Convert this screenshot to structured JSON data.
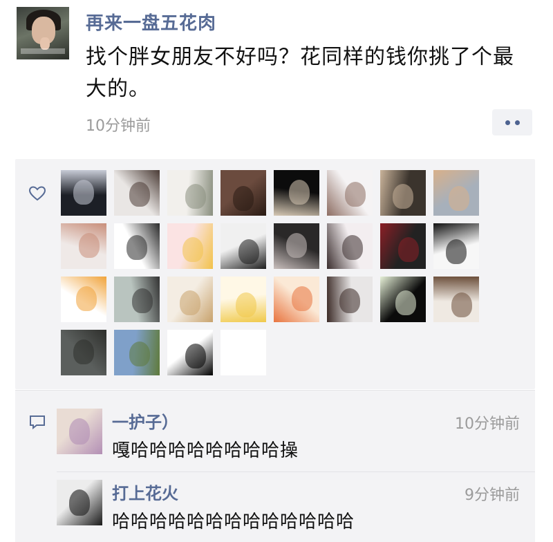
{
  "post": {
    "author": "再来一盘五花肉",
    "text": "找个胖女朋友不好吗？花同样的钱你挑了个最大的。",
    "time": "10分钟前",
    "avatar_caption": "",
    "more_icon": "more-dots-icon"
  },
  "likes": {
    "icon": "heart-icon",
    "avatars": [
      {
        "name": "liker-1",
        "colors": [
          "#1c1f26",
          "#c7cbd6"
        ]
      },
      {
        "name": "liker-2",
        "colors": [
          "#e9e6e4",
          "#4a3b35"
        ]
      },
      {
        "name": "liker-3",
        "colors": [
          "#f2f0ec",
          "#8a8f7f"
        ]
      },
      {
        "name": "liker-4",
        "colors": [
          "#6b4b3e",
          "#2a1b14"
        ]
      },
      {
        "name": "liker-5",
        "colors": [
          "#0c0c0c",
          "#d7c9b5"
        ]
      },
      {
        "name": "liker-6",
        "colors": [
          "#f5f3f4",
          "#8d6d62"
        ]
      },
      {
        "name": "liker-7",
        "colors": [
          "#3b342d",
          "#c9b39a"
        ]
      },
      {
        "name": "liker-8",
        "colors": [
          "#a7b0bb",
          "#d8b08a"
        ]
      },
      {
        "name": "liker-9",
        "colors": [
          "#efe9e7",
          "#c88e7a"
        ]
      },
      {
        "name": "liker-10",
        "colors": [
          "#ffffff",
          "#2b2b2b"
        ]
      },
      {
        "name": "liker-11",
        "colors": [
          "#fbe3e3",
          "#f2c24a"
        ]
      },
      {
        "name": "liker-12",
        "colors": [
          "#f0f0f0",
          "#1d1d1d"
        ]
      },
      {
        "name": "liker-13",
        "colors": [
          "#2a2828",
          "#c9bfbd"
        ]
      },
      {
        "name": "liker-14",
        "colors": [
          "#f3eef0",
          "#3a2d2d"
        ]
      },
      {
        "name": "liker-15",
        "colors": [
          "#222222",
          "#8c1f26"
        ]
      },
      {
        "name": "liker-16",
        "colors": [
          "#f7f7f7",
          "#111111"
        ]
      },
      {
        "name": "liker-17",
        "colors": [
          "#ffffff",
          "#f0a33a"
        ]
      },
      {
        "name": "liker-18",
        "colors": [
          "#b9c4bf",
          "#333333"
        ]
      },
      {
        "name": "liker-19",
        "colors": [
          "#f4ede3",
          "#c8a26c"
        ]
      },
      {
        "name": "liker-20",
        "colors": [
          "#fff8e6",
          "#f0c94a"
        ]
      },
      {
        "name": "liker-21",
        "colors": [
          "#fbe9d6",
          "#e8743f"
        ]
      },
      {
        "name": "liker-22",
        "colors": [
          "#e8e6e6",
          "#3b2a26"
        ]
      },
      {
        "name": "liker-23",
        "colors": [
          "#0b0b0b",
          "#e7f1d8"
        ]
      },
      {
        "name": "liker-24",
        "colors": [
          "#efe9e2",
          "#6b4e3a"
        ]
      },
      {
        "name": "liker-25",
        "colors": [
          "#5b5f5d",
          "#2e2f2c"
        ]
      },
      {
        "name": "liker-26",
        "colors": [
          "#7fa0c9",
          "#5f7a3b"
        ]
      },
      {
        "name": "liker-27",
        "colors": [
          "#ffffff",
          "#000000"
        ]
      },
      {
        "name": "liker-28",
        "colors": [
          "#ffffff",
          "#ffffff"
        ]
      }
    ]
  },
  "comments": {
    "icon": "comment-bubble-icon",
    "items": [
      {
        "name": "一护子）",
        "time": "10分钟前",
        "text": "嘎哈哈哈哈哈哈哈哈操",
        "avatar_colors": [
          "#e9dcd4",
          "#b38fb5"
        ]
      },
      {
        "name": "打上花火",
        "time": "9分钟前",
        "text": "哈哈哈哈哈哈哈哈哈哈哈哈哈",
        "avatar_colors": [
          "#ececec",
          "#1a1a1a"
        ]
      }
    ]
  },
  "colors": {
    "link": "#576b95",
    "panel": "#f3f3f5",
    "text": "#111111",
    "muted": "#9b9b9b"
  }
}
